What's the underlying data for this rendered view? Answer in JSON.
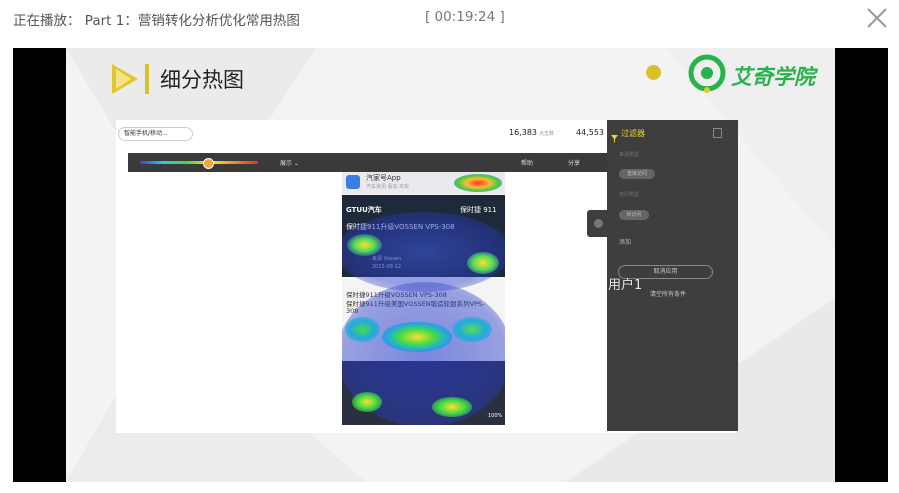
{
  "header": {
    "now_playing": "正在播放： Part 1：营销转化分析优化常用热图",
    "timestamp": "[ 00:19:24 ]",
    "close_icon": "close-icon"
  },
  "slide": {
    "title": "细分热图",
    "logo_text": "艾奇学院",
    "accent_color": "#d7c22b",
    "brand_color": "#27b34a",
    "screenshot": {
      "dropdown_label": "智能手机/移动...",
      "stat1_value": "16,383",
      "stat1_label": "点击数",
      "stat2_value": "44,553",
      "toolbar": {
        "display": "展示 ⌄",
        "help": "帮助",
        "share": "分享"
      },
      "phone": {
        "app_name": "汽家号App",
        "app_sub": "汽车资讯·看车·买车",
        "hero_brand": "GTUU汽车",
        "hero_right": "保时捷 911",
        "hero_headline": "保时捷911升级VOSSEN VPS-308",
        "hero_author": "来源 Vossen",
        "hero_date": "2015-08-12",
        "article_line1": "保时捷911升级VOSSEN VPS-308",
        "article_line2": "保时捷911升级美国VOSSEN锻造轮毂系列VPS-",
        "article_line3": "308",
        "percent": "100%"
      },
      "filter": {
        "title": "过滤器",
        "label1": "来源类型",
        "chip1": "直接访问",
        "label2": "访问类型",
        "chip2": "新访问",
        "add": "添加",
        "apply": "取消应用",
        "clear": "清空所有条件"
      },
      "overlay_label": "用户1"
    }
  }
}
